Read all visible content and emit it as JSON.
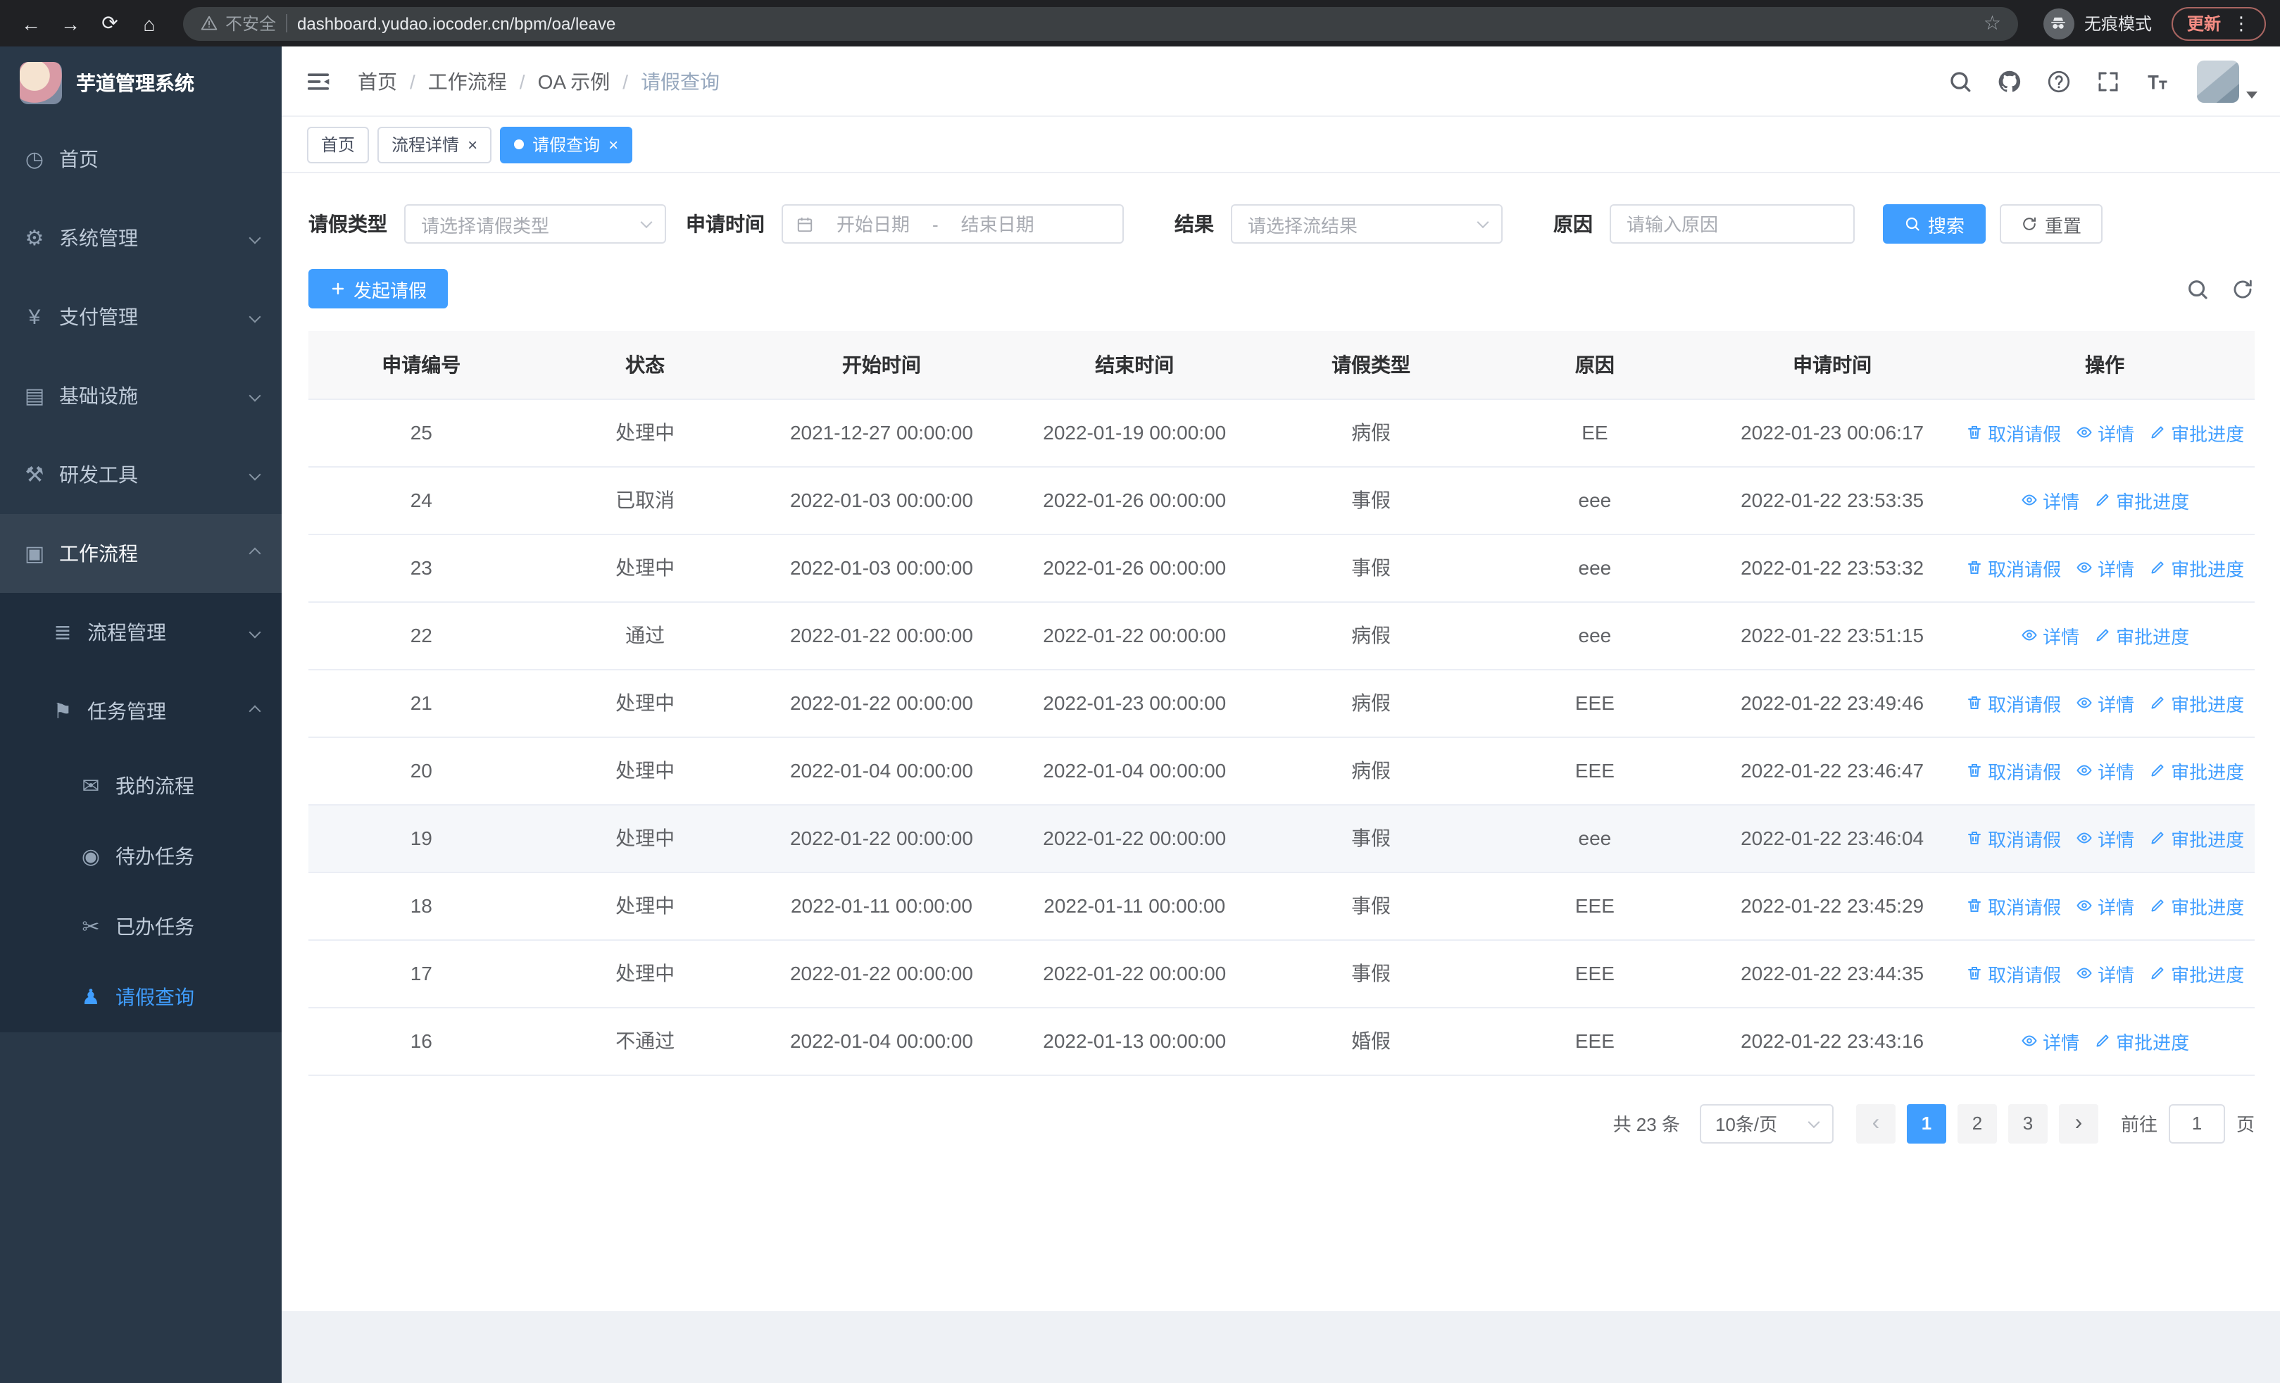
{
  "browser": {
    "security_warning": "不安全",
    "url": "dashboard.yudao.iocoder.cn/bpm/oa/leave",
    "incognito_label": "无痕模式",
    "update_label": "更新"
  },
  "sidebar": {
    "logo_title": "芋道管理系统",
    "menu": [
      {
        "key": "home",
        "label": "首页",
        "icon": "dashboard-icon",
        "glyph": "◷",
        "level": 1
      },
      {
        "key": "system",
        "label": "系统管理",
        "icon": "gear-icon",
        "glyph": "⚙",
        "level": 1,
        "chevron": "down"
      },
      {
        "key": "payment",
        "label": "支付管理",
        "icon": "yen-icon",
        "glyph": "¥",
        "level": 1,
        "chevron": "down"
      },
      {
        "key": "infrastructure",
        "label": "基础设施",
        "icon": "monitor-icon",
        "glyph": "▤",
        "level": 1,
        "chevron": "down"
      },
      {
        "key": "devtools",
        "label": "研发工具",
        "icon": "tools-icon",
        "glyph": "⚒",
        "level": 1,
        "chevron": "down"
      },
      {
        "key": "workflow",
        "label": "工作流程",
        "icon": "briefcase-icon",
        "glyph": "▣",
        "level": 1,
        "chevron": "up",
        "active_parent": true
      },
      {
        "key": "process-management",
        "label": "流程管理",
        "icon": "process-list-icon",
        "glyph": "≣",
        "level": 2,
        "chevron": "down"
      },
      {
        "key": "task-management",
        "label": "任务管理",
        "icon": "flag-icon",
        "glyph": "⚑",
        "level": 2,
        "chevron": "up"
      },
      {
        "key": "my-process",
        "label": "我的流程",
        "icon": "chat-icon",
        "glyph": "✉",
        "level": 3
      },
      {
        "key": "todo-tasks",
        "label": "待办任务",
        "icon": "eye-icon",
        "glyph": "◉",
        "level": 3
      },
      {
        "key": "done-tasks",
        "label": "已办任务",
        "icon": "scissors-icon",
        "glyph": "✂",
        "level": 3
      },
      {
        "key": "leave-query",
        "label": "请假查询",
        "icon": "user-icon",
        "glyph": "♟",
        "level": 3,
        "active": true
      }
    ]
  },
  "header": {
    "breadcrumb": [
      "首页",
      "工作流程",
      "OA 示例",
      "请假查询"
    ]
  },
  "tabs": [
    {
      "key": "home",
      "label": "首页",
      "closable": false,
      "active": false
    },
    {
      "key": "process-detail",
      "label": "流程详情",
      "closable": true,
      "active": false
    },
    {
      "key": "leave-query",
      "label": "请假查询",
      "closable": true,
      "active": true
    }
  ],
  "filters": {
    "leave_type_label": "请假类型",
    "leave_type_placeholder": "请选择请假类型",
    "apply_time_label": "申请时间",
    "start_date_placeholder": "开始日期",
    "range_separator": "-",
    "end_date_placeholder": "结束日期",
    "result_label": "结果",
    "result_placeholder": "请选择流结果",
    "reason_label": "原因",
    "reason_placeholder": "请输入原因",
    "search_label": "搜索",
    "reset_label": "重置"
  },
  "toolbar": {
    "create_label": "发起请假"
  },
  "table": {
    "columns": [
      "申请编号",
      "状态",
      "开始时间",
      "结束时间",
      "请假类型",
      "原因",
      "申请时间",
      "操作"
    ],
    "action_labels": {
      "cancel": "取消请假",
      "detail": "详情",
      "progress": "审批进度"
    },
    "rows": [
      {
        "number": "25",
        "status": "处理中",
        "start_time": "2021-12-27 00:00:00",
        "end_time": "2022-01-19 00:00:00",
        "leave_type": "病假",
        "reason": "EE",
        "apply_time": "2022-01-23 00:06:17",
        "actions": [
          "cancel",
          "detail",
          "progress"
        ]
      },
      {
        "number": "24",
        "status": "已取消",
        "start_time": "2022-01-03 00:00:00",
        "end_time": "2022-01-26 00:00:00",
        "leave_type": "事假",
        "reason": "eee",
        "apply_time": "2022-01-22 23:53:35",
        "actions": [
          "detail",
          "progress"
        ]
      },
      {
        "number": "23",
        "status": "处理中",
        "start_time": "2022-01-03 00:00:00",
        "end_time": "2022-01-26 00:00:00",
        "leave_type": "事假",
        "reason": "eee",
        "apply_time": "2022-01-22 23:53:32",
        "actions": [
          "cancel",
          "detail",
          "progress"
        ]
      },
      {
        "number": "22",
        "status": "通过",
        "start_time": "2022-01-22 00:00:00",
        "end_time": "2022-01-22 00:00:00",
        "leave_type": "病假",
        "reason": "eee",
        "apply_time": "2022-01-22 23:51:15",
        "actions": [
          "detail",
          "progress"
        ]
      },
      {
        "number": "21",
        "status": "处理中",
        "start_time": "2022-01-22 00:00:00",
        "end_time": "2022-01-23 00:00:00",
        "leave_type": "病假",
        "reason": "EEE",
        "apply_time": "2022-01-22 23:49:46",
        "actions": [
          "cancel",
          "detail",
          "progress"
        ]
      },
      {
        "number": "20",
        "status": "处理中",
        "start_time": "2022-01-04 00:00:00",
        "end_time": "2022-01-04 00:00:00",
        "leave_type": "病假",
        "reason": "EEE",
        "apply_time": "2022-01-22 23:46:47",
        "actions": [
          "cancel",
          "detail",
          "progress"
        ]
      },
      {
        "number": "19",
        "status": "处理中",
        "start_time": "2022-01-22 00:00:00",
        "end_time": "2022-01-22 00:00:00",
        "leave_type": "事假",
        "reason": "eee",
        "apply_time": "2022-01-22 23:46:04",
        "actions": [
          "cancel",
          "detail",
          "progress"
        ],
        "highlighted": true
      },
      {
        "number": "18",
        "status": "处理中",
        "start_time": "2022-01-11 00:00:00",
        "end_time": "2022-01-11 00:00:00",
        "leave_type": "事假",
        "reason": "EEE",
        "apply_time": "2022-01-22 23:45:29",
        "actions": [
          "cancel",
          "detail",
          "progress"
        ]
      },
      {
        "number": "17",
        "status": "处理中",
        "start_time": "2022-01-22 00:00:00",
        "end_time": "2022-01-22 00:00:00",
        "leave_type": "事假",
        "reason": "EEE",
        "apply_time": "2022-01-22 23:44:35",
        "actions": [
          "cancel",
          "detail",
          "progress"
        ]
      },
      {
        "number": "16",
        "status": "不通过",
        "start_time": "2022-01-04 00:00:00",
        "end_time": "2022-01-13 00:00:00",
        "leave_type": "婚假",
        "reason": "EEE",
        "apply_time": "2022-01-22 23:43:16",
        "actions": [
          "detail",
          "progress"
        ]
      }
    ]
  },
  "pagination": {
    "total_text": "共 23 条",
    "page_size": "10条/页",
    "pages": [
      "1",
      "2",
      "3"
    ],
    "active_page": "1",
    "goto_prefix": "前往",
    "goto_value": "1",
    "goto_suffix": "页"
  },
  "colors": {
    "primary": "#409eff",
    "sidebar_bg": "#293848",
    "sidebar_submenu_bg": "#1f2d3d"
  }
}
